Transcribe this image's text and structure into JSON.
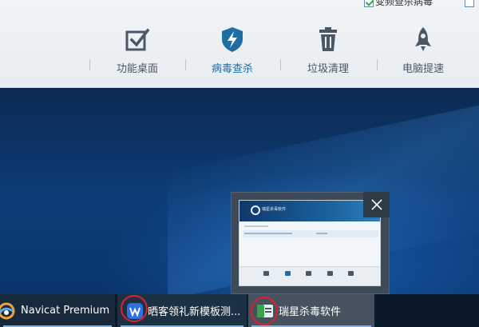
{
  "top_strip": {
    "checkbox_label": "变频查杀病毒"
  },
  "toolbar": {
    "items": [
      {
        "label": "功能桌面",
        "icon": "checkbox-icon",
        "active": false
      },
      {
        "label": "病毒查杀",
        "icon": "shield-bolt-icon",
        "active": true
      },
      {
        "label": "垃圾清理",
        "icon": "trash-icon",
        "active": false
      },
      {
        "label": "电脑提速",
        "icon": "rocket-icon",
        "active": false
      }
    ]
  },
  "preview": {
    "app_title": "瑞星杀毒软件",
    "close_icon": "close-icon"
  },
  "taskbar": {
    "items": [
      {
        "label": "Navicat Premium",
        "icon": "navicat-icon"
      },
      {
        "label": "晒客领礼新模板测...",
        "icon": "wps-icon"
      },
      {
        "label": "瑞星杀毒软件",
        "icon": "rising-antivirus-icon"
      }
    ]
  },
  "colors": {
    "accent": "#1f6ea3",
    "annotation_circle": "#e0212b"
  }
}
